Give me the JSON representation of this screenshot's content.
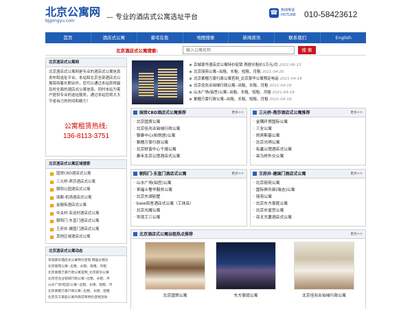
{
  "header": {
    "logo_cn": "北京公寓网",
    "logo_en": "bjgongyu.com",
    "slogan": "— 专业的酒店式公寓选址平台",
    "hotline_label": "热线电话",
    "hotline_label_en": "HOTLINE",
    "phone": "010-58423612"
  },
  "nav": [
    "首页",
    "酒店式公寓",
    "豪宅在售",
    "地图搜索",
    "新闻资讯",
    "联系我们",
    "English"
  ],
  "search": {
    "label": "北京酒店式公寓搜索:",
    "placeholder": "输入公寓名称",
    "button": "搜 索"
  },
  "left": {
    "intro_title": "北京酒店式公寓网",
    "intro_text": "北京酒店式公寓网是专业的酒店式公寓信息发布和选址平台，本站和北京全部酒店式公寓保持着长期合作，您可以通过本站获得最及时全面的酒店式公寓信息。同时本站为客户提供专业的选址服务，通过本站您将大大节省自己的时间和精力！",
    "hot_title": "公寓租赁热线:",
    "hot_phone": "136-8113-3751",
    "area_title": "北京酒店式公寓区域搜索",
    "areas": [
      "国贸CBD酒店式公寓",
      "三元桥-燕莎酒店式公寓",
      "朝阳公园酒店式公寓",
      "丽都-机场酒店式公寓",
      "金融街酒店式公寓",
      "中关村-亚运村酒店式公寓",
      "朝阳门-东直门酒店式公寓",
      "王府井-建国门酒店式公寓",
      "其他区域酒店式公寓"
    ],
    "dyn_title": "北京酒店式公寓动态",
    "dyn_items": [
      "京城豪华酒店式公寓特价促销 两居长租价",
      "北京丽苑公寓--出租、长租、短租、月租",
      "北京紫檀万豪行政公寓官网_北京豪华公寓",
      "北京佳兆业铂域行政公寓--出租、长租、月",
      "山水广场(铂宫)公寓--出租、长租、短租、月",
      "北京紫檀万豪行政公寓--出租、长租、短租",
      "北京东方豪庭公寓月底前有特价促销活动"
    ]
  },
  "news": [
    {
      "title": "京城豪华酒店式公寓特价促销 两居长租价1万元/月",
      "date": "2021-06-15"
    },
    {
      "title": "北京丽苑公寓--出租、长租、短租、月租",
      "date": "2021-04-20"
    },
    {
      "title": "北京紫檀万豪行政公寓官网_北京豪华公寓预定电话",
      "date": "2021-04-18"
    },
    {
      "title": "北京佳兆业铂域行政公寓--出租、长租、月租",
      "date": "2021-04-18"
    },
    {
      "title": "山水广场(铂宫)公寓--出租、长租、短租、月租",
      "date": "2021-04-19"
    },
    {
      "title": "紫檀万豪行政公寓--出租、长租、短租、月租",
      "date": "2021-04-18"
    }
  ],
  "sections": [
    {
      "title": "国贸CBD酒店式公寓推荐",
      "more": "更多>>",
      "items": [
        "北京国贸公寓",
        "北京佳兆业铂域行政公寓",
        "银泰中心(柏悦居)公寓",
        "紫檀万豪行政公寓",
        "北京财富中心千禧公寓",
        "泰禾北京公馆酒店式公寓"
      ]
    },
    {
      "title": "三元桥-燕莎酒店式公寓推荐",
      "more": "更多>>",
      "items": [
        "金隅环贸国际公寓",
        "三全公寓",
        "凯宾斯基公寓",
        "北京光明公寓",
        "有巢公馆酒店式公寓",
        "亮马桥外交公寓"
      ]
    },
    {
      "title": "朝阳门-东直门酒店式公寓",
      "more": "更多>>",
      "items": [
        "山水广场(铂宫)公寓",
        "来福士奢华服务公寓",
        "北京东湖别墅",
        "base佰舍酒店式公寓（工体店）",
        "北京光耀公寓",
        "世茂工三公寓"
      ]
    },
    {
      "title": "王府井-建国门酒店式公寓",
      "more": "更多>>",
      "items": [
        "北京丽苑公寓",
        "国际俱乐部(瑞吉)公寓",
        "丽苑公寓",
        "北京东方豪庭公寓",
        "北京长富宫公寓",
        "亚太大厦酒店式公寓"
      ]
    }
  ],
  "photos_title": "北京酒店式公寓出租热点推荐",
  "photos_more": "更多>>",
  "photos": [
    "北京国贸公寓",
    "东方豪庭公寓",
    "北京佳兆业铂域行政公寓"
  ]
}
